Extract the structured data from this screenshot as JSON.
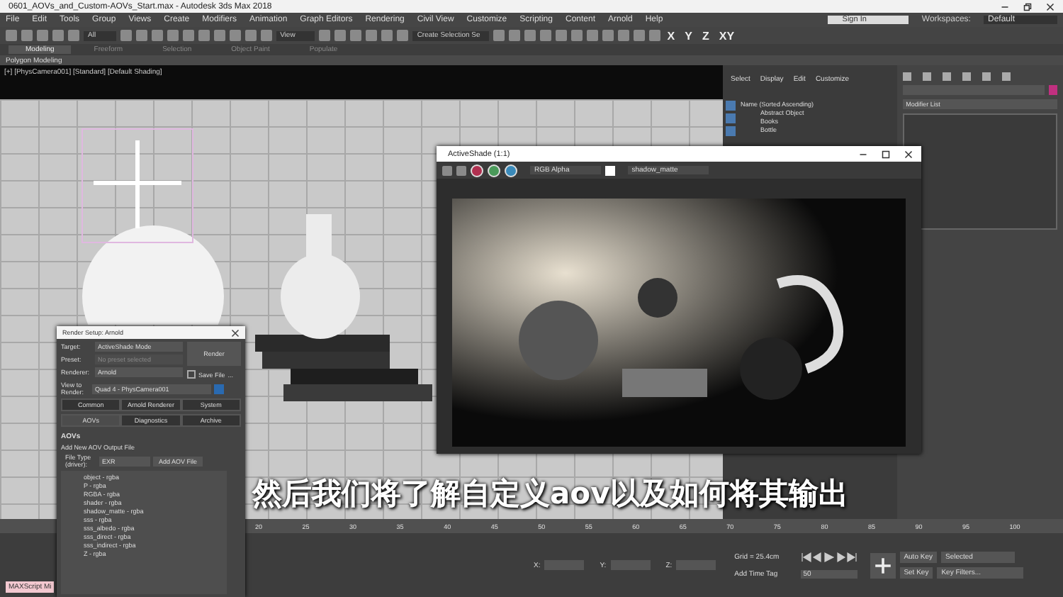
{
  "window": {
    "title": "0601_AOVs_and_Custom-AOVs_Start.max - Autodesk 3ds Max 2018"
  },
  "menu": [
    "File",
    "Edit",
    "Tools",
    "Group",
    "Views",
    "Create",
    "Modifiers",
    "Animation",
    "Graph Editors",
    "Rendering",
    "Civil View",
    "Customize",
    "Scripting",
    "Content",
    "Arnold",
    "Help"
  ],
  "account": {
    "sign_in": "Sign In",
    "workspaces_label": "Workspaces:",
    "workspace": "Default"
  },
  "toolbar": {
    "filter": "All",
    "view": "View",
    "selection_set": "Create Selection Se",
    "axes": [
      "X",
      "Y",
      "Z",
      "XY"
    ]
  },
  "ribbon": {
    "tabs": [
      {
        "label": "Modeling",
        "selected": true
      },
      {
        "label": "Freeform",
        "selected": false
      },
      {
        "label": "Selection",
        "selected": false
      },
      {
        "label": "Object Paint",
        "selected": false
      },
      {
        "label": "Populate",
        "selected": false
      }
    ],
    "panel": "Polygon Modeling"
  },
  "viewport": {
    "label": "[+] [PhysCamera001] [Standard] [Default Shading]"
  },
  "scene_explorer": {
    "tabs": [
      "Select",
      "Display",
      "Edit",
      "Customize"
    ],
    "header": "Name (Sorted Ascending)",
    "items": [
      "Abstract Object",
      "Books",
      "Bottle"
    ]
  },
  "command_panel": {
    "modifier_list": "Modifier List"
  },
  "activeshade": {
    "title": "ActiveShade (1:1)",
    "channel": "RGB Alpha",
    "element": "shadow_matte"
  },
  "render_setup": {
    "title": "Render Setup: Arnold",
    "fields": [
      {
        "label": "Target:",
        "value": "ActiveShade Mode",
        "disabled": false
      },
      {
        "label": "Preset:",
        "value": "No preset selected",
        "disabled": true
      },
      {
        "label": "Renderer:",
        "value": "Arnold",
        "disabled": false
      }
    ],
    "render_button": "Render",
    "save_file": {
      "label": "Save File",
      "checked": false
    },
    "more": "...",
    "view_label": "View to Render:",
    "view": "Quad 4 - PhysCamera001",
    "tabs": [
      [
        {
          "label": "Common",
          "selected": false
        },
        {
          "label": "Arnold Renderer",
          "selected": false
        },
        {
          "label": "System",
          "selected": false
        }
      ],
      [
        {
          "label": "AOVs",
          "selected": true
        },
        {
          "label": "Diagnostics",
          "selected": false
        },
        {
          "label": "Archive",
          "selected": false
        }
      ]
    ],
    "section": "AOVs",
    "add_label": "Add New AOV Output File",
    "file_type_label": "File Type (driver):",
    "file_type": "EXR",
    "add_button": "Add AOV File",
    "aovs": [
      "object - rgba",
      "P - rgba",
      "RGBA - rgba",
      "shader - rgba",
      "shadow_matte - rgba",
      "sss - rgba",
      "sss_albedo - rgba",
      "sss_direct - rgba",
      "sss_indirect - rgba",
      "Z - rgba"
    ]
  },
  "subtitle": "然后我们将了解自定义aov以及如何将其输出",
  "timeline": {
    "ticks": [
      "20",
      "25",
      "30",
      "35",
      "40",
      "45",
      "50",
      "55",
      "60",
      "65",
      "70",
      "75",
      "80",
      "85",
      "90",
      "95",
      "100"
    ]
  },
  "status": {
    "script": "MAXScript Mi",
    "x": "X:",
    "y": "Y:",
    "z": "Z:",
    "grid": "Grid = 25.4cm",
    "time_tag": "Add Time Tag",
    "frame": "50",
    "auto_key": "Auto Key",
    "selected": "Selected",
    "set_key": "Set Key",
    "key_filters": "Key Filters..."
  }
}
